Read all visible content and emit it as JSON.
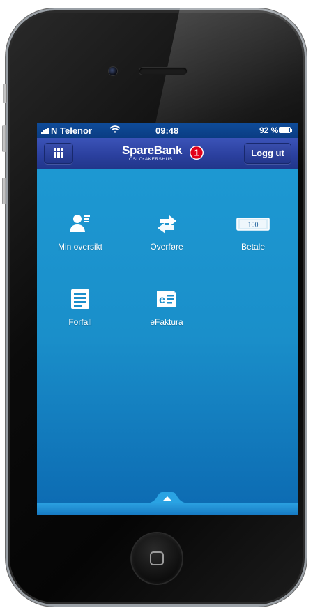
{
  "status_bar": {
    "carrier": "N Telenor",
    "time": "09:48",
    "battery_percent": "92 %",
    "battery_level": 0.92
  },
  "nav": {
    "brand_name": "SpareBank",
    "brand_badge": "1",
    "brand_subtitle": "OSLO•AKERSHUS",
    "logout_label": "Logg ut"
  },
  "tiles": [
    {
      "label": "Min oversikt",
      "icon": "person-overview-icon"
    },
    {
      "label": "Overføre",
      "icon": "transfer-arrows-icon"
    },
    {
      "label": "Betale",
      "icon": "banknote-icon",
      "icon_text": "100"
    },
    {
      "label": "Forfall",
      "icon": "list-icon"
    },
    {
      "label": "eFaktura",
      "icon": "efaktura-icon"
    }
  ],
  "colors": {
    "status_bar": "#0f4c9a",
    "nav_bar": "#2a3f9d",
    "content": "#1d98d2",
    "brand_red": "#e2001a"
  }
}
